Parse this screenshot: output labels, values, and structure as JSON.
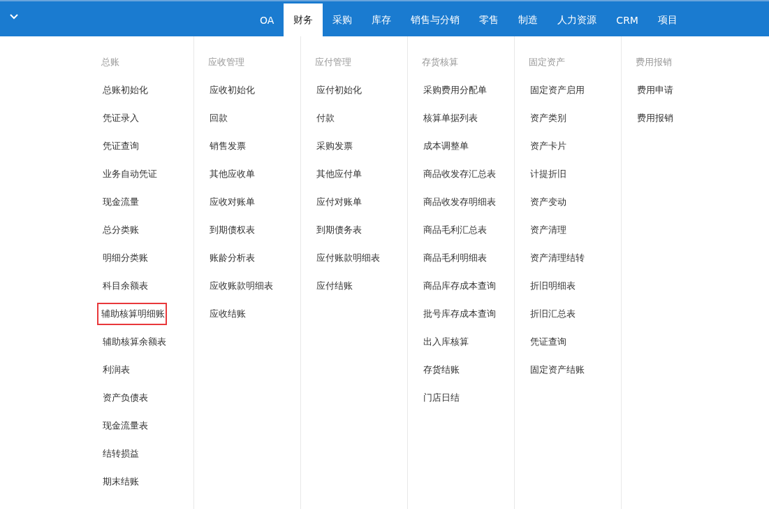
{
  "tabs": [
    {
      "label": "OA",
      "selected": false
    },
    {
      "label": "财务",
      "selected": true
    },
    {
      "label": "采购",
      "selected": false
    },
    {
      "label": "库存",
      "selected": false
    },
    {
      "label": "销售与分销",
      "selected": false
    },
    {
      "label": "零售",
      "selected": false
    },
    {
      "label": "制造",
      "selected": false
    },
    {
      "label": "人力资源",
      "selected": false
    },
    {
      "label": "CRM",
      "selected": false
    },
    {
      "label": "项目",
      "selected": false
    }
  ],
  "columns": [
    {
      "heading": "总账",
      "items": [
        {
          "label": "总账初始化",
          "highlighted": false
        },
        {
          "label": "凭证录入",
          "highlighted": false
        },
        {
          "label": "凭证查询",
          "highlighted": false
        },
        {
          "label": "业务自动凭证",
          "highlighted": false
        },
        {
          "label": "现金流量",
          "highlighted": false
        },
        {
          "label": "总分类账",
          "highlighted": false
        },
        {
          "label": "明细分类账",
          "highlighted": false
        },
        {
          "label": "科目余额表",
          "highlighted": false
        },
        {
          "label": "辅助核算明细账",
          "highlighted": true
        },
        {
          "label": "辅助核算余额表",
          "highlighted": false
        },
        {
          "label": "利润表",
          "highlighted": false
        },
        {
          "label": "资产负债表",
          "highlighted": false
        },
        {
          "label": "现金流量表",
          "highlighted": false
        },
        {
          "label": "结转损益",
          "highlighted": false
        },
        {
          "label": "期末结账",
          "highlighted": false
        }
      ]
    },
    {
      "heading": "应收管理",
      "items": [
        {
          "label": "应收初始化",
          "highlighted": false
        },
        {
          "label": "回款",
          "highlighted": false
        },
        {
          "label": "销售发票",
          "highlighted": false
        },
        {
          "label": "其他应收单",
          "highlighted": false
        },
        {
          "label": "应收对账单",
          "highlighted": false
        },
        {
          "label": "到期债权表",
          "highlighted": false
        },
        {
          "label": "账龄分析表",
          "highlighted": false
        },
        {
          "label": "应收账款明细表",
          "highlighted": false
        },
        {
          "label": "应收结账",
          "highlighted": false
        }
      ]
    },
    {
      "heading": "应付管理",
      "items": [
        {
          "label": "应付初始化",
          "highlighted": false
        },
        {
          "label": "付款",
          "highlighted": false
        },
        {
          "label": "采购发票",
          "highlighted": false
        },
        {
          "label": "其他应付单",
          "highlighted": false
        },
        {
          "label": "应付对账单",
          "highlighted": false
        },
        {
          "label": "到期债务表",
          "highlighted": false
        },
        {
          "label": "应付账款明细表",
          "highlighted": false
        },
        {
          "label": "应付结账",
          "highlighted": false
        }
      ]
    },
    {
      "heading": "存货核算",
      "items": [
        {
          "label": "采购费用分配单",
          "highlighted": false
        },
        {
          "label": "核算单据列表",
          "highlighted": false
        },
        {
          "label": "成本调整单",
          "highlighted": false
        },
        {
          "label": "商品收发存汇总表",
          "highlighted": false
        },
        {
          "label": "商品收发存明细表",
          "highlighted": false
        },
        {
          "label": "商品毛利汇总表",
          "highlighted": false
        },
        {
          "label": "商品毛利明细表",
          "highlighted": false
        },
        {
          "label": "商品库存成本查询",
          "highlighted": false
        },
        {
          "label": "批号库存成本查询",
          "highlighted": false
        },
        {
          "label": "出入库核算",
          "highlighted": false
        },
        {
          "label": "存货结账",
          "highlighted": false
        },
        {
          "label": "门店日结",
          "highlighted": false
        }
      ]
    },
    {
      "heading": "固定资产",
      "items": [
        {
          "label": "固定资产启用",
          "highlighted": false
        },
        {
          "label": "资产类别",
          "highlighted": false
        },
        {
          "label": "资产卡片",
          "highlighted": false
        },
        {
          "label": "计提折旧",
          "highlighted": false
        },
        {
          "label": "资产变动",
          "highlighted": false
        },
        {
          "label": "资产清理",
          "highlighted": false
        },
        {
          "label": "资产清理结转",
          "highlighted": false
        },
        {
          "label": "折旧明细表",
          "highlighted": false
        },
        {
          "label": "折旧汇总表",
          "highlighted": false
        },
        {
          "label": "凭证查询",
          "highlighted": false
        },
        {
          "label": "固定资产结账",
          "highlighted": false
        }
      ]
    },
    {
      "heading": "费用报销",
      "items": [
        {
          "label": "费用申请",
          "highlighted": false
        },
        {
          "label": "费用报销",
          "highlighted": false
        }
      ]
    }
  ]
}
